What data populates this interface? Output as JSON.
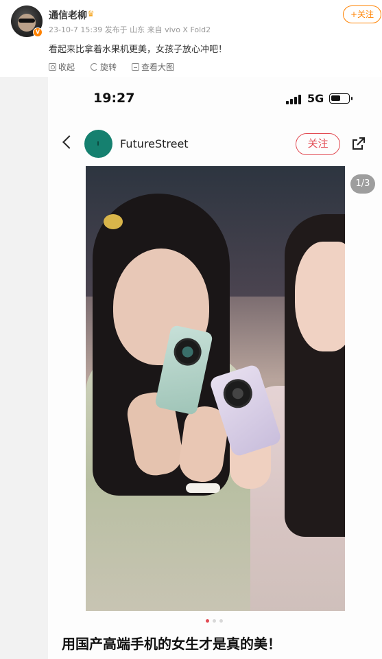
{
  "post": {
    "author": "通信老柳",
    "meta": "23-10-7 15:39 发布于 山东 来自 vivo X Fold2",
    "follow_label": "+关注",
    "text": "看起来比拿着水果机更美，女孩子放心冲吧！",
    "verify_mark": "V"
  },
  "toolbar": {
    "save_label": "收起",
    "rotate_label": "旋转",
    "view_label": "查看大图"
  },
  "screenshot": {
    "status": {
      "time": "19:27",
      "network": "5G"
    },
    "account": {
      "name": "FutureStreet",
      "follow_label": "关注"
    },
    "page_indicator": "1/3",
    "caption": "用国产高端手机的女生才是真的美！"
  }
}
